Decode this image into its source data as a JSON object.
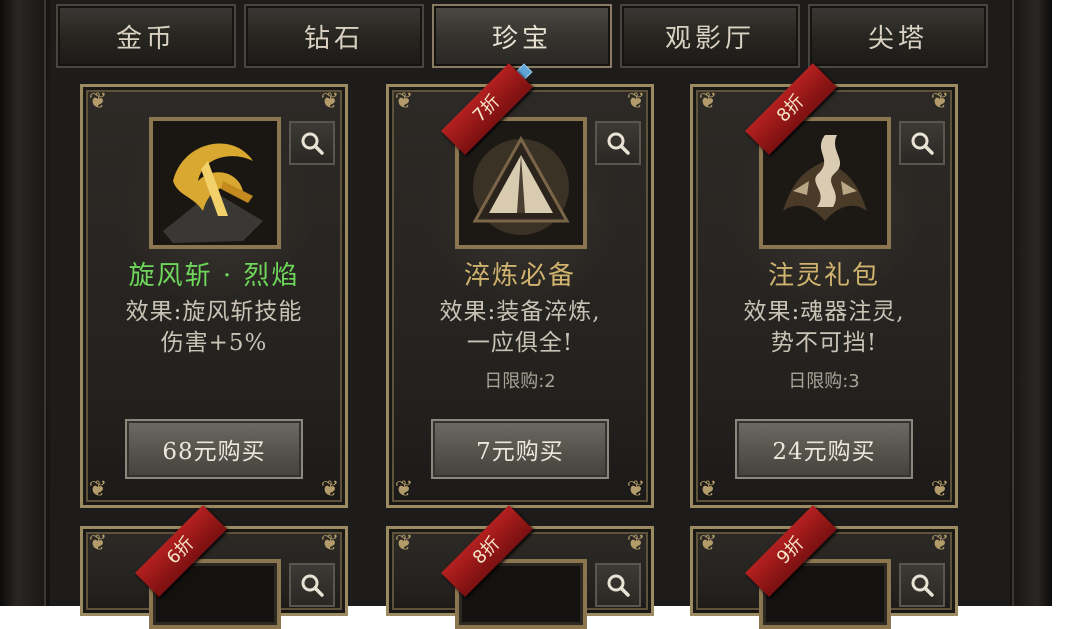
{
  "tabs": [
    {
      "label": "金币",
      "active": false
    },
    {
      "label": "钻石",
      "active": false
    },
    {
      "label": "珍宝",
      "active": true
    },
    {
      "label": "观影厅",
      "active": false
    },
    {
      "label": "尖塔",
      "active": false
    }
  ],
  "items": [
    {
      "name": "旋风斩 · 烈焰",
      "name_color": "green",
      "discount": "",
      "desc_line1": "效果:旋风斩技能",
      "desc_line2": "伤害+5%",
      "limit": "",
      "buy_label": "68元购买",
      "icon": "whirlwind-flame-icon"
    },
    {
      "name": "淬炼必备",
      "name_color": "gold",
      "discount": "7折",
      "desc_line1": "效果:装备淬炼,",
      "desc_line2": "一应俱全!",
      "limit": "日限购:2",
      "buy_label": "7元购买",
      "icon": "refine-triangle-icon"
    },
    {
      "name": "注灵礼包",
      "name_color": "gold",
      "discount": "8折",
      "desc_line1": "效果:魂器注灵,",
      "desc_line2": "势不可挡!",
      "limit": "日限购:3",
      "buy_label": "24元购买",
      "icon": "soul-rune-icon"
    }
  ],
  "lower_items": [
    {
      "discount": "6折"
    },
    {
      "discount": "8折"
    },
    {
      "discount": "9折"
    }
  ],
  "colors": {
    "name_green": "#6ed65a",
    "name_gold": "#cfb36e",
    "ribbon_red": "#b42020",
    "frame_gold": "#9c8a62"
  }
}
